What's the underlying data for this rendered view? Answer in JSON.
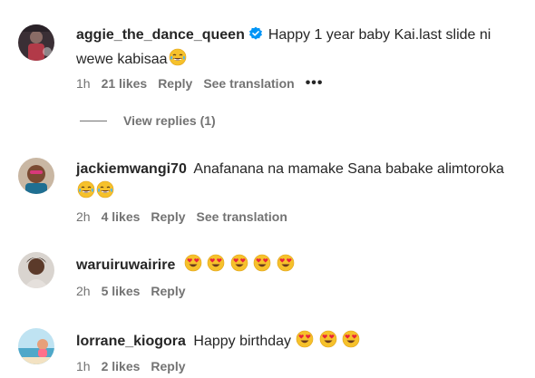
{
  "comments": [
    {
      "username": "aggie_the_dance_queen",
      "verified": true,
      "text": "Happy 1 year baby Kai.last slide ni wewe kabisaa",
      "emojis": [
        "tears-of-joy"
      ],
      "time": "1h",
      "likes": "21 likes",
      "reply": "Reply",
      "translate": "See translation",
      "more": "•••",
      "view_replies": "View replies (1)"
    },
    {
      "username": "jackiemwangi70",
      "verified": false,
      "text": "Anafanana na mamake Sana babake alimtoroka",
      "emojis": [
        "tears-of-joy",
        "tears-of-joy"
      ],
      "time": "2h",
      "likes": "4 likes",
      "reply": "Reply",
      "translate": "See translation"
    },
    {
      "username": "waruiruwairire",
      "verified": false,
      "text": "",
      "emojis": [
        "heart-eyes",
        "heart-eyes",
        "heart-eyes",
        "heart-eyes",
        "heart-eyes"
      ],
      "time": "2h",
      "likes": "5 likes",
      "reply": "Reply"
    },
    {
      "username": "lorrane_kiogora",
      "verified": false,
      "text": "Happy birthday",
      "emojis": [
        "heart-eyes",
        "heart-eyes",
        "heart-eyes"
      ],
      "time": "1h",
      "likes": "2 likes",
      "reply": "Reply"
    }
  ],
  "colors": {
    "text": "#262626",
    "secondary": "#737373",
    "verified": "#0095f6"
  }
}
